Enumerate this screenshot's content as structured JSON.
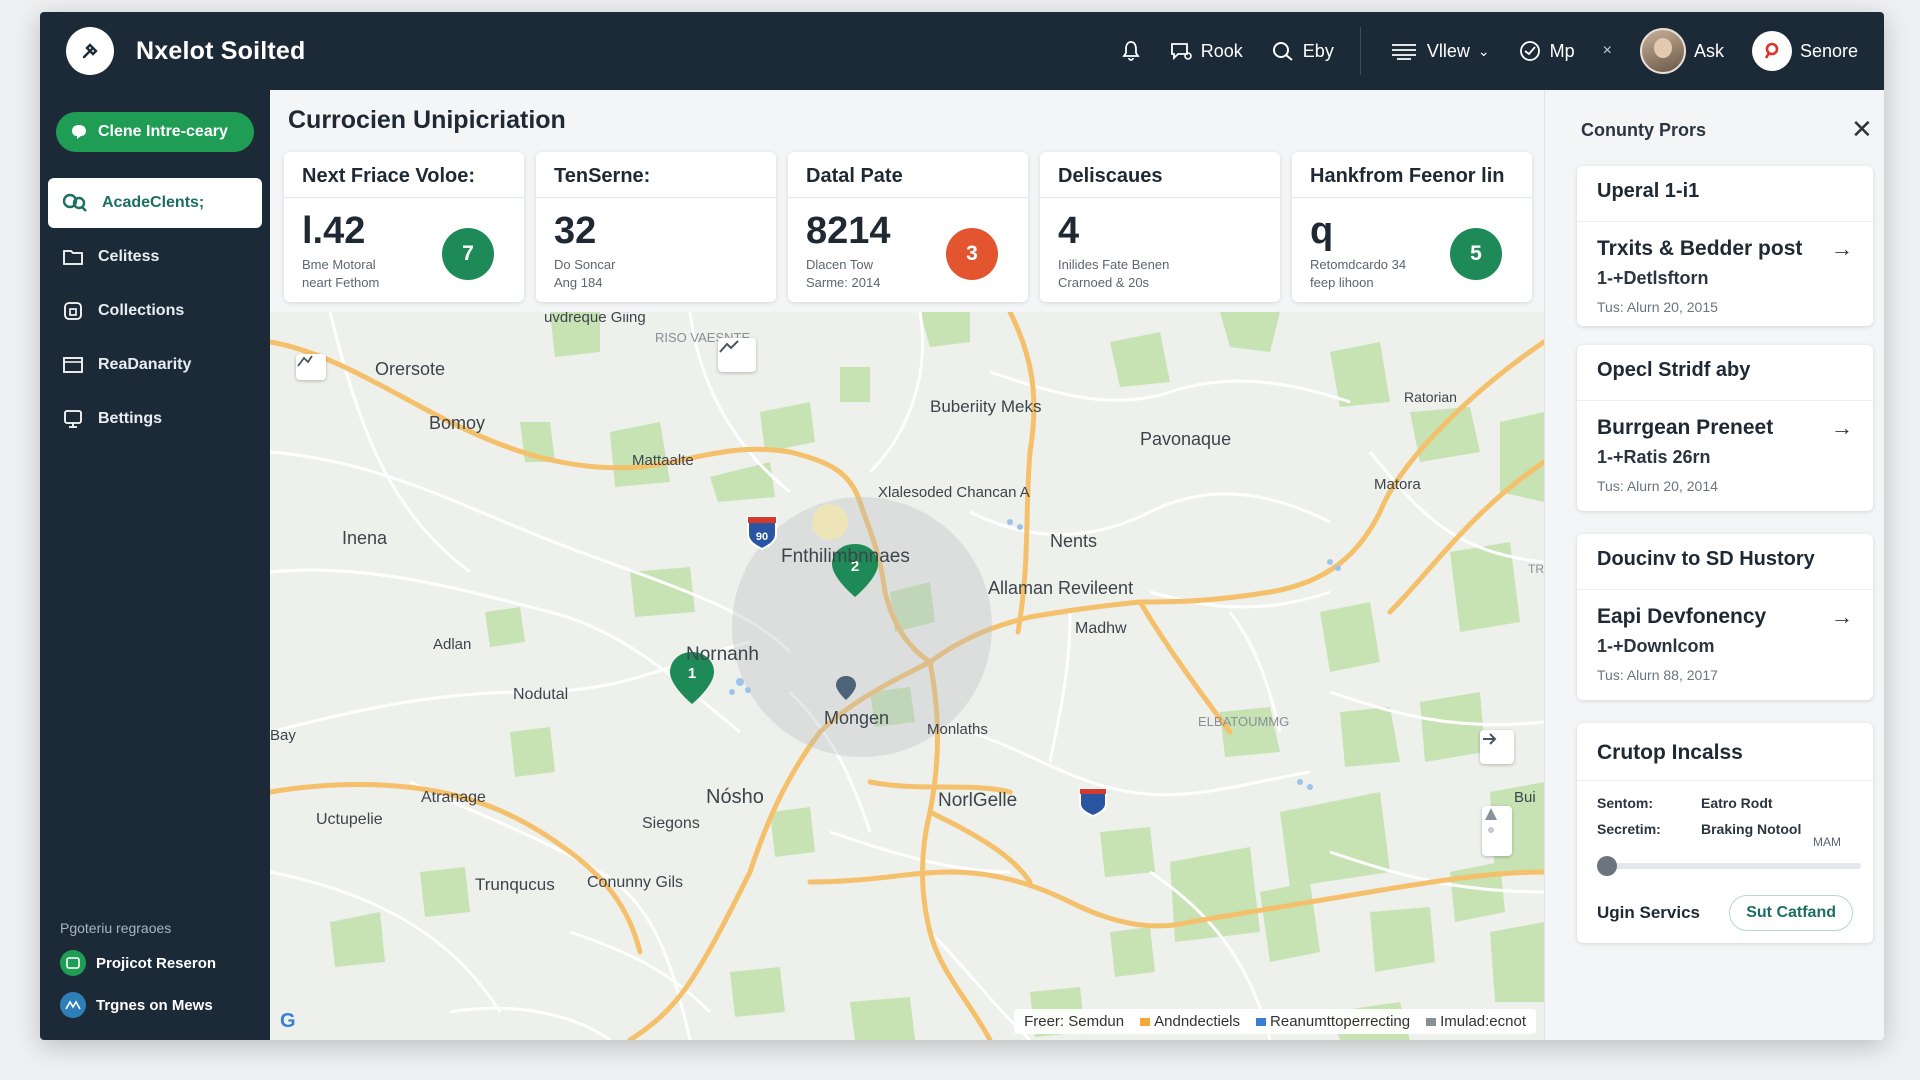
{
  "app": {
    "title": "Nxelot Soilted"
  },
  "topbar": {
    "items": [
      {
        "label": "",
        "icon": "bell-icon"
      },
      {
        "label": "Rook",
        "icon": "chat-icon"
      },
      {
        "label": "Eby",
        "icon": "search-icon"
      },
      {
        "label": "Vllew",
        "icon": "layers-icon",
        "caret": "⌄"
      },
      {
        "label": "Mp",
        "icon": "globe-icon"
      }
    ],
    "close_glyph": "×",
    "user_label": "Ask",
    "profile_label": "Senore"
  },
  "sidebar": {
    "cta_label": "Clene Intre-ceary",
    "items": [
      {
        "label": "AcadeClents;",
        "icon": "people-icon",
        "active": true
      },
      {
        "label": "Celitess",
        "icon": "folder-icon",
        "active": false
      },
      {
        "label": "Collections",
        "icon": "lock-icon",
        "active": false
      },
      {
        "label": "ReaDanarity",
        "icon": "inbox-icon",
        "active": false
      },
      {
        "label": "Bettings",
        "icon": "monitor-icon",
        "active": false
      }
    ],
    "footer_title": "Pgoteriu regraoes",
    "footer_items": [
      {
        "label": "Projicot Reseron",
        "icon": "project-icon",
        "color": "#1f9d55"
      },
      {
        "label": "Trgnes on Mews",
        "icon": "news-icon",
        "color": "#2e7fb8"
      }
    ]
  },
  "main": {
    "title": "Currocien Unipicriation",
    "stats": [
      {
        "title": "Next Friace Voloe:",
        "value": "l.42",
        "sub": "Bme Motoral\nneart Fethom",
        "badge": "7",
        "badge_color": "#1e8a57"
      },
      {
        "title": "TenSerne:",
        "value": "32",
        "sub": "Do Soncar\nAng 184",
        "badge": "",
        "badge_color": ""
      },
      {
        "title": "Datal Pate",
        "value": "8214",
        "sub": "Dlacen Tow\nSarme: 2014",
        "badge": "3",
        "badge_color": "#e2552f"
      },
      {
        "title": "Deliscaues",
        "value": "4",
        "sub": "Inilides Fate Benen\nCrarnoed & 20s",
        "badge": "",
        "badge_color": ""
      },
      {
        "title": "Hankfrom Feenor lin",
        "value": "q",
        "sub": "Retomdcardo 34\nfeep lihoon",
        "badge": "5",
        "badge_color": "#1e8a57"
      }
    ]
  },
  "map": {
    "place_labels": [
      "uvdreque Giing",
      "RISO VAESNTE",
      "Orersote",
      "Bomoy",
      "Mattaalte",
      "Buberiity Meks",
      "Ratorian",
      "Pavonaque",
      "Matora",
      "Xlalesoded Chancan A",
      "Fnthilimbnnaes",
      "Nents",
      "Allaman Revileent",
      "Inena",
      "Adlan",
      "Nornanh",
      "Madhw",
      "Nodutal",
      "Mongen",
      "Monlaths",
      "ELBATOUMMG",
      "Bay",
      "Atranage",
      "Nósho",
      "NorlGelle",
      "Bui",
      "Uctupelie",
      "Siegons",
      "Trunqucus",
      "Conunny Gils",
      "TRYS"
    ],
    "shields": [
      "90"
    ],
    "markers": [
      {
        "label": "2",
        "color": "#1e8a57"
      },
      {
        "label": "1",
        "color": "#1e8a57"
      }
    ],
    "attribution": {
      "free": "Freer: Semdun",
      "items": [
        {
          "label": "Andndectiels",
          "color": "#f2a93b"
        },
        {
          "label": "Reanumttoperrecting",
          "color": "#3b7fd4"
        },
        {
          "label": "Imulad:ecnot",
          "color": "#8a8f96"
        }
      ]
    },
    "google_logo": "G"
  },
  "right_panel": {
    "title": "Conunty Prors",
    "close_glyph": "✕",
    "posts": [
      {
        "header": "Uperal 1-i1",
        "title": "Trxits & Bedder post",
        "meta": "1-+Detlsftorn",
        "date": "Tus: Alurn 20, 2015"
      },
      {
        "header": "Opecl Stridf aby",
        "title": "Burrgean Preneet",
        "meta": "1-+Ratis 26rn",
        "date": "Tus: Alurn 20, 2014"
      },
      {
        "header": "Doucinv to SD Hustory",
        "title": "Eapi Devfonency",
        "meta": "1-+Downlcom",
        "date": "Tus: Alurn 88, 2017"
      }
    ],
    "crutop": {
      "title": "Crutop Incalss",
      "rows": [
        {
          "key": "Sentom:",
          "value": "Eatro Rodt"
        },
        {
          "key": "Secretim:",
          "value": "Braking Notool"
        }
      ],
      "slider_max_label": "MAM",
      "slider_value": 0,
      "footer_label": "Ugin Servics",
      "footer_button": "Sut Catfand"
    }
  }
}
